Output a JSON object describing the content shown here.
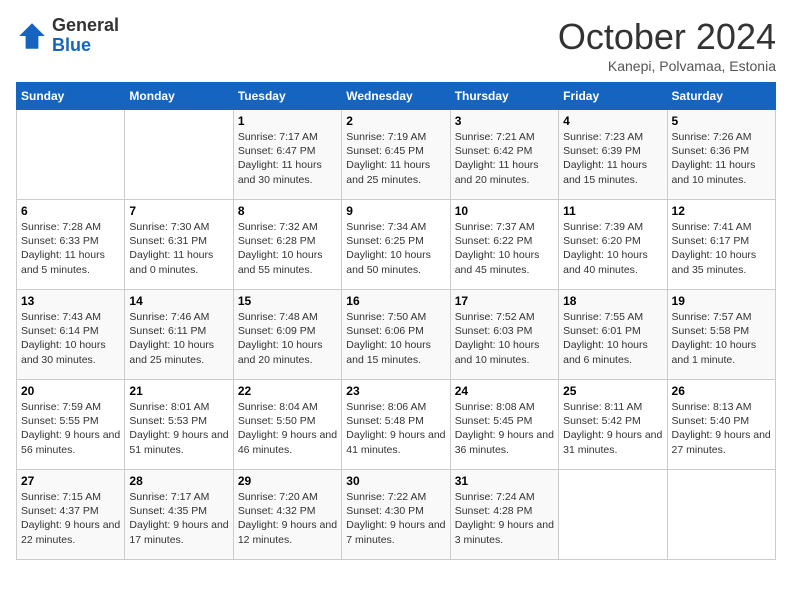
{
  "header": {
    "logo_general": "General",
    "logo_blue": "Blue",
    "month_title": "October 2024",
    "subtitle": "Kanepi, Polvamaa, Estonia"
  },
  "days_of_week": [
    "Sunday",
    "Monday",
    "Tuesday",
    "Wednesday",
    "Thursday",
    "Friday",
    "Saturday"
  ],
  "weeks": [
    [
      {
        "day": "",
        "sunrise": "",
        "sunset": "",
        "daylight": ""
      },
      {
        "day": "",
        "sunrise": "",
        "sunset": "",
        "daylight": ""
      },
      {
        "day": "1",
        "sunrise": "Sunrise: 7:17 AM",
        "sunset": "Sunset: 6:47 PM",
        "daylight": "Daylight: 11 hours and 30 minutes."
      },
      {
        "day": "2",
        "sunrise": "Sunrise: 7:19 AM",
        "sunset": "Sunset: 6:45 PM",
        "daylight": "Daylight: 11 hours and 25 minutes."
      },
      {
        "day": "3",
        "sunrise": "Sunrise: 7:21 AM",
        "sunset": "Sunset: 6:42 PM",
        "daylight": "Daylight: 11 hours and 20 minutes."
      },
      {
        "day": "4",
        "sunrise": "Sunrise: 7:23 AM",
        "sunset": "Sunset: 6:39 PM",
        "daylight": "Daylight: 11 hours and 15 minutes."
      },
      {
        "day": "5",
        "sunrise": "Sunrise: 7:26 AM",
        "sunset": "Sunset: 6:36 PM",
        "daylight": "Daylight: 11 hours and 10 minutes."
      }
    ],
    [
      {
        "day": "6",
        "sunrise": "Sunrise: 7:28 AM",
        "sunset": "Sunset: 6:33 PM",
        "daylight": "Daylight: 11 hours and 5 minutes."
      },
      {
        "day": "7",
        "sunrise": "Sunrise: 7:30 AM",
        "sunset": "Sunset: 6:31 PM",
        "daylight": "Daylight: 11 hours and 0 minutes."
      },
      {
        "day": "8",
        "sunrise": "Sunrise: 7:32 AM",
        "sunset": "Sunset: 6:28 PM",
        "daylight": "Daylight: 10 hours and 55 minutes."
      },
      {
        "day": "9",
        "sunrise": "Sunrise: 7:34 AM",
        "sunset": "Sunset: 6:25 PM",
        "daylight": "Daylight: 10 hours and 50 minutes."
      },
      {
        "day": "10",
        "sunrise": "Sunrise: 7:37 AM",
        "sunset": "Sunset: 6:22 PM",
        "daylight": "Daylight: 10 hours and 45 minutes."
      },
      {
        "day": "11",
        "sunrise": "Sunrise: 7:39 AM",
        "sunset": "Sunset: 6:20 PM",
        "daylight": "Daylight: 10 hours and 40 minutes."
      },
      {
        "day": "12",
        "sunrise": "Sunrise: 7:41 AM",
        "sunset": "Sunset: 6:17 PM",
        "daylight": "Daylight: 10 hours and 35 minutes."
      }
    ],
    [
      {
        "day": "13",
        "sunrise": "Sunrise: 7:43 AM",
        "sunset": "Sunset: 6:14 PM",
        "daylight": "Daylight: 10 hours and 30 minutes."
      },
      {
        "day": "14",
        "sunrise": "Sunrise: 7:46 AM",
        "sunset": "Sunset: 6:11 PM",
        "daylight": "Daylight: 10 hours and 25 minutes."
      },
      {
        "day": "15",
        "sunrise": "Sunrise: 7:48 AM",
        "sunset": "Sunset: 6:09 PM",
        "daylight": "Daylight: 10 hours and 20 minutes."
      },
      {
        "day": "16",
        "sunrise": "Sunrise: 7:50 AM",
        "sunset": "Sunset: 6:06 PM",
        "daylight": "Daylight: 10 hours and 15 minutes."
      },
      {
        "day": "17",
        "sunrise": "Sunrise: 7:52 AM",
        "sunset": "Sunset: 6:03 PM",
        "daylight": "Daylight: 10 hours and 10 minutes."
      },
      {
        "day": "18",
        "sunrise": "Sunrise: 7:55 AM",
        "sunset": "Sunset: 6:01 PM",
        "daylight": "Daylight: 10 hours and 6 minutes."
      },
      {
        "day": "19",
        "sunrise": "Sunrise: 7:57 AM",
        "sunset": "Sunset: 5:58 PM",
        "daylight": "Daylight: 10 hours and 1 minute."
      }
    ],
    [
      {
        "day": "20",
        "sunrise": "Sunrise: 7:59 AM",
        "sunset": "Sunset: 5:55 PM",
        "daylight": "Daylight: 9 hours and 56 minutes."
      },
      {
        "day": "21",
        "sunrise": "Sunrise: 8:01 AM",
        "sunset": "Sunset: 5:53 PM",
        "daylight": "Daylight: 9 hours and 51 minutes."
      },
      {
        "day": "22",
        "sunrise": "Sunrise: 8:04 AM",
        "sunset": "Sunset: 5:50 PM",
        "daylight": "Daylight: 9 hours and 46 minutes."
      },
      {
        "day": "23",
        "sunrise": "Sunrise: 8:06 AM",
        "sunset": "Sunset: 5:48 PM",
        "daylight": "Daylight: 9 hours and 41 minutes."
      },
      {
        "day": "24",
        "sunrise": "Sunrise: 8:08 AM",
        "sunset": "Sunset: 5:45 PM",
        "daylight": "Daylight: 9 hours and 36 minutes."
      },
      {
        "day": "25",
        "sunrise": "Sunrise: 8:11 AM",
        "sunset": "Sunset: 5:42 PM",
        "daylight": "Daylight: 9 hours and 31 minutes."
      },
      {
        "day": "26",
        "sunrise": "Sunrise: 8:13 AM",
        "sunset": "Sunset: 5:40 PM",
        "daylight": "Daylight: 9 hours and 27 minutes."
      }
    ],
    [
      {
        "day": "27",
        "sunrise": "Sunrise: 7:15 AM",
        "sunset": "Sunset: 4:37 PM",
        "daylight": "Daylight: 9 hours and 22 minutes."
      },
      {
        "day": "28",
        "sunrise": "Sunrise: 7:17 AM",
        "sunset": "Sunset: 4:35 PM",
        "daylight": "Daylight: 9 hours and 17 minutes."
      },
      {
        "day": "29",
        "sunrise": "Sunrise: 7:20 AM",
        "sunset": "Sunset: 4:32 PM",
        "daylight": "Daylight: 9 hours and 12 minutes."
      },
      {
        "day": "30",
        "sunrise": "Sunrise: 7:22 AM",
        "sunset": "Sunset: 4:30 PM",
        "daylight": "Daylight: 9 hours and 7 minutes."
      },
      {
        "day": "31",
        "sunrise": "Sunrise: 7:24 AM",
        "sunset": "Sunset: 4:28 PM",
        "daylight": "Daylight: 9 hours and 3 minutes."
      },
      {
        "day": "",
        "sunrise": "",
        "sunset": "",
        "daylight": ""
      },
      {
        "day": "",
        "sunrise": "",
        "sunset": "",
        "daylight": ""
      }
    ]
  ]
}
